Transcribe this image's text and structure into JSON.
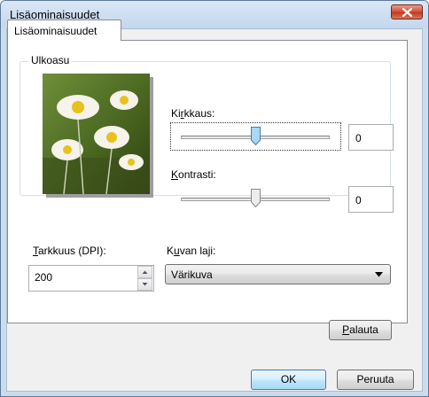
{
  "window": {
    "title": "Lisäominaisuudet"
  },
  "tab": {
    "label": "Lisäominaisuudet"
  },
  "appearance": {
    "group_label": "Ulkoasu",
    "brightness": {
      "label_pre": "Ki",
      "label_accel": "r",
      "label_post": "kkaus:",
      "value": "0",
      "level": 0.5
    },
    "contrast": {
      "label_pre": "",
      "label_accel": "K",
      "label_post": "ontrasti:",
      "value": "0",
      "level": 0.5
    }
  },
  "resolution": {
    "label_accel": "T",
    "label_post": "arkkuus (DPI):",
    "value": "200"
  },
  "picture_type": {
    "label_pre": "K",
    "label_accel": "u",
    "label_post": "van laji:",
    "selected": "Värikuva"
  },
  "buttons": {
    "reset": {
      "accel": "P",
      "rest": "alauta"
    },
    "ok": "OK",
    "cancel": "Peruuta"
  },
  "icons": [
    "close-icon",
    "spin-up-icon",
    "spin-down-icon",
    "chevron-down-icon",
    "slider-thumb-icon"
  ]
}
